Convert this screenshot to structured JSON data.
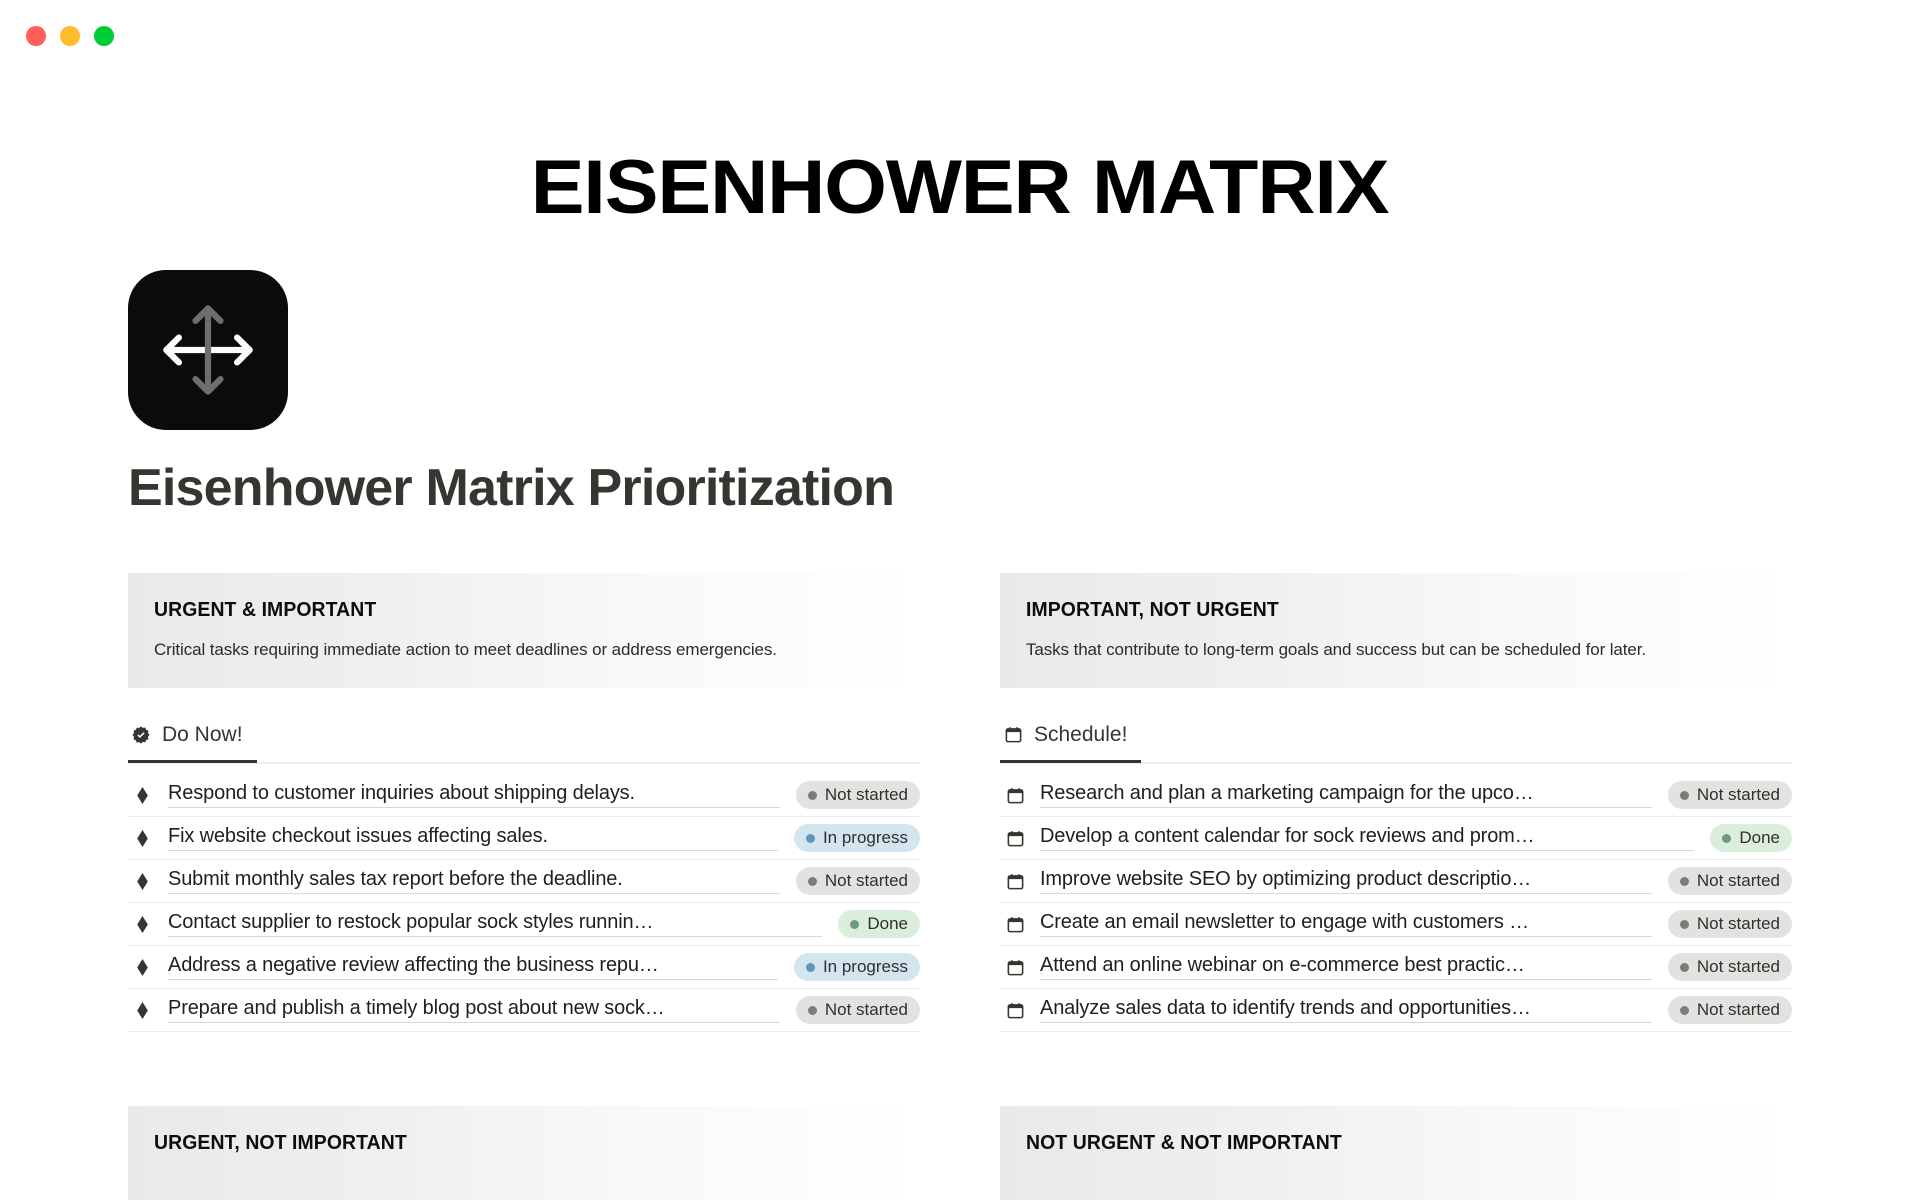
{
  "window": {
    "lights": [
      "close",
      "minimize",
      "maximize"
    ]
  },
  "banner": {
    "title": "EISENHOWER MATRIX"
  },
  "header": {
    "icon_name": "move-arrows-icon",
    "page_title": "Eisenhower Matrix Prioritization"
  },
  "status_styles": {
    "not_started_bg": "#E3E2E0",
    "not_started_dot": "#7C7C78",
    "in_progress_bg": "#D3E5EF",
    "in_progress_dot": "#5B97BD",
    "done_bg": "#DBEDDB",
    "done_dot": "#6C9B7D"
  },
  "quadrants": [
    {
      "id": "urgent-important",
      "name": "URGENT & IMPORTANT",
      "description": "Critical tasks requiring immediate action to meet deadlines or address emergencies.",
      "tab": {
        "label": "Do Now!",
        "icon": "verified-badge-icon"
      },
      "bullet_icon": "diamond-icon",
      "tasks": [
        {
          "text": "Respond to customer inquiries about shipping delays.",
          "status": "Not started",
          "status_key": "notstarted"
        },
        {
          "text": "Fix website checkout issues affecting sales.",
          "status": "In progress",
          "status_key": "inprogress"
        },
        {
          "text": "Submit monthly sales tax report before the deadline.",
          "status": "Not started",
          "status_key": "notstarted"
        },
        {
          "text": "Contact supplier to restock popular sock styles runnin…",
          "status": "Done",
          "status_key": "done"
        },
        {
          "text": "Address a negative review affecting the business repu…",
          "status": "In progress",
          "status_key": "inprogress"
        },
        {
          "text": "Prepare and publish a timely blog post about new sock…",
          "status": "Not started",
          "status_key": "notstarted"
        }
      ]
    },
    {
      "id": "important-not-urgent",
      "name": "IMPORTANT, NOT URGENT",
      "description": "Tasks that contribute to long-term goals and success but can be scheduled for later.",
      "tab": {
        "label": "Schedule!",
        "icon": "calendar-icon"
      },
      "bullet_icon": "calendar-icon",
      "tasks": [
        {
          "text": "Research and plan a marketing campaign for the upco…",
          "status": "Not started",
          "status_key": "notstarted"
        },
        {
          "text": "Develop a content calendar for sock reviews and prom…",
          "status": "Done",
          "status_key": "done"
        },
        {
          "text": "Improve website SEO by optimizing product descriptio…",
          "status": "Not started",
          "status_key": "notstarted"
        },
        {
          "text": "Create an email newsletter to engage with customers …",
          "status": "Not started",
          "status_key": "notstarted"
        },
        {
          "text": "Attend an online webinar on e-commerce best practic…",
          "status": "Not started",
          "status_key": "notstarted"
        },
        {
          "text": "Analyze sales data to identify trends and opportunities…",
          "status": "Not started",
          "status_key": "notstarted"
        }
      ]
    },
    {
      "id": "urgent-not-important",
      "name": "URGENT, NOT IMPORTANT",
      "description": "",
      "tab": {
        "label": "",
        "icon": ""
      },
      "bullet_icon": "",
      "tasks": []
    },
    {
      "id": "not-urgent-not-important",
      "name": "NOT URGENT & NOT IMPORTANT",
      "description": "",
      "tab": {
        "label": "",
        "icon": ""
      },
      "bullet_icon": "",
      "tasks": []
    }
  ]
}
